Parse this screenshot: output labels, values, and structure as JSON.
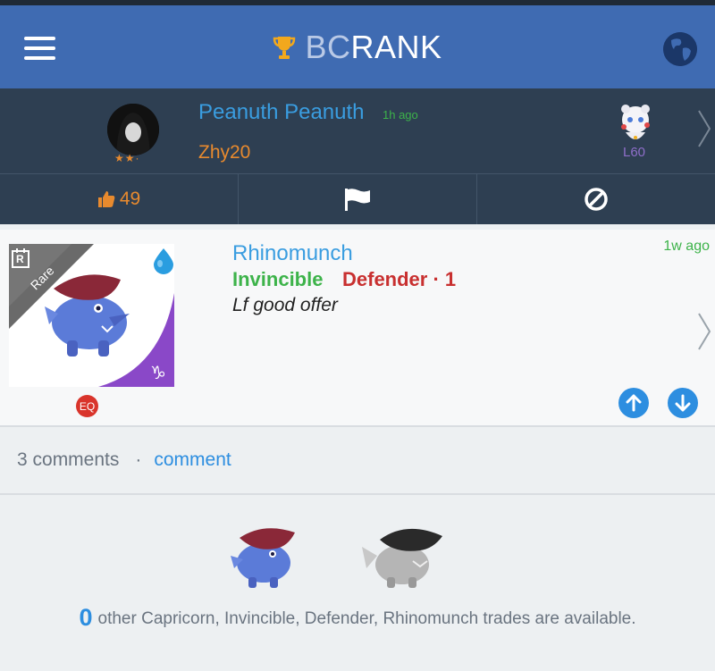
{
  "header": {
    "brand_prefix": "BC",
    "brand_suffix": "RANK",
    "accent_color": "#3f6bb2"
  },
  "trade_owner": {
    "name": "Peanuth Peanuth",
    "posted_ago": "1h ago",
    "wants": "Zhy20",
    "stars": "★★·",
    "level": "L60",
    "likes": "49"
  },
  "listing": {
    "pet_name": "Rhinomunch",
    "trait_1": "Invincible",
    "trait_2": "Defender · 1",
    "note": "Lf good offer",
    "posted_ago": "1w ago",
    "rarity": "Rare",
    "rarity_tag": "R",
    "eq_badge": "EQ",
    "element_icon": "water-drop-icon",
    "zodiac_icon": "capricorn-icon"
  },
  "comments": {
    "count_label": "3 comments",
    "separator": "·",
    "comment_link": "comment"
  },
  "others": {
    "count": "0",
    "text": "other Capricorn, Invincible, Defender, Rhinomunch trades are available."
  }
}
